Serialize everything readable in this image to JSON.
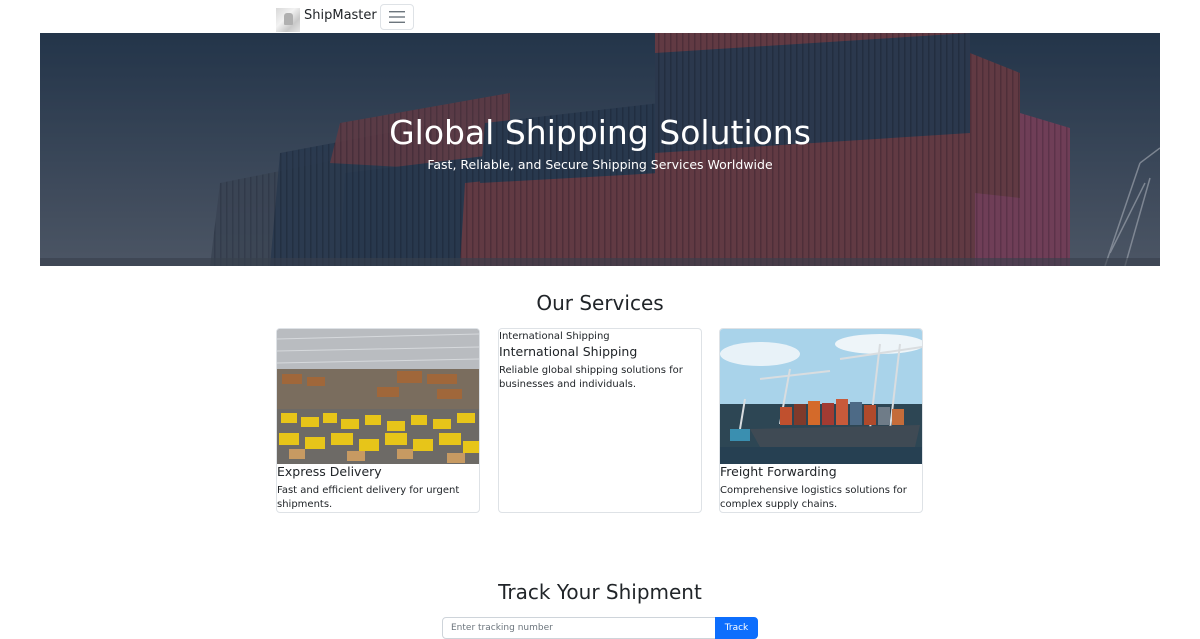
{
  "navbar": {
    "brand": "ShipMaster",
    "logo_icon": "brand-logo-icon",
    "toggler_icon": "hamburger-menu-icon"
  },
  "hero": {
    "title": "Global Shipping Solutions",
    "subtitle": "Fast, Reliable, and Secure Shipping Services Worldwide"
  },
  "services": {
    "title": "Our Services",
    "cards": [
      {
        "title": "Express Delivery",
        "text": "Fast and efficient delivery for urgent shipments.",
        "image": "warehouse-photo"
      },
      {
        "title": "International Shipping",
        "text": "Reliable global shipping solutions for businesses and individuals.",
        "image_alt": "International Shipping"
      },
      {
        "title": "Freight Forwarding",
        "text": "Comprehensive logistics solutions for complex supply chains.",
        "image": "cargo-ship-port-photo"
      }
    ]
  },
  "track": {
    "title": "Track Your Shipment",
    "placeholder": "Enter tracking number",
    "button_label": "Track"
  },
  "colors": {
    "primary": "#0d6efd",
    "text": "#212529",
    "border": "#dee2e6"
  }
}
